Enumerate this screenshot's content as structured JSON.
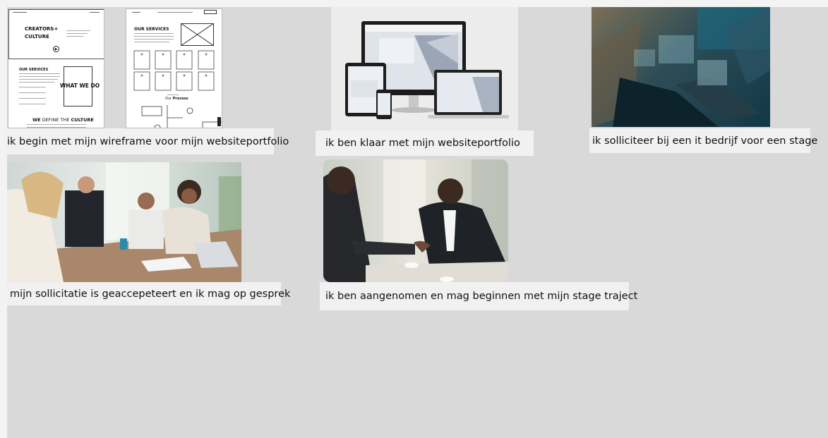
{
  "captions": {
    "c1": "ik begin met mijn wireframe voor mijn websiteportfolio",
    "c2": "ik ben klaar met mijn websiteportfolio",
    "c3": "ik solliciteer bij een it bedrijf voor een stage",
    "c4": "mijn sollicitatie is geaccepeteert en ik mag op gesprek",
    "c5": "ik ben aangenomen en mag beginnen met mijn stage traject"
  },
  "wireframe1": {
    "hero_title_1": "CREATORS+",
    "hero_title_2": "CULTURE",
    "section_title": "OUR SERVICES",
    "what_we_do": "WHAT WE DO",
    "culture_pre": "WE",
    "culture_mid": " DEFINE THE ",
    "culture_post": "CULTURE"
  },
  "wireframe2": {
    "services_title": "OUR SERVICES",
    "process_title_a": "Our ",
    "process_title_b": "Process"
  },
  "colors": {
    "board": "#d9d9d9",
    "caption_bg": "#f1f1f1"
  }
}
